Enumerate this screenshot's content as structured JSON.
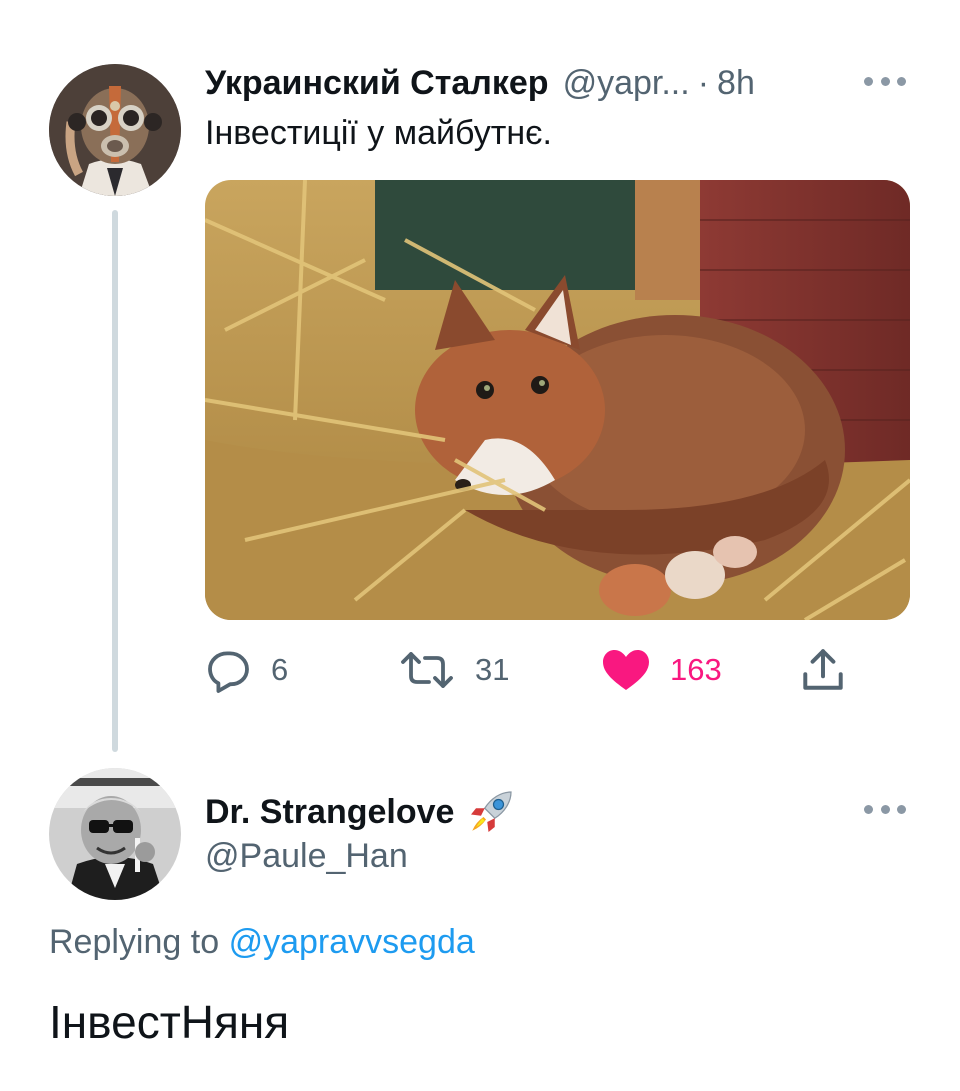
{
  "tweet_1": {
    "display_name": "Украинский Сталкер",
    "handle": "@yapr...",
    "separator": "·",
    "time": "8h",
    "text": "Інвестиції у майбутнє.",
    "avatar_icon": "gas-mask-avatar",
    "media_icon": "fox-in-nest-photo",
    "actions": {
      "reply_count": "6",
      "retweet_count": "31",
      "like_count": "163",
      "liked": true
    }
  },
  "tweet_2": {
    "display_name": "Dr. Strangelove",
    "name_emoji_icon": "rocket-icon",
    "handle": "@Paule_Han",
    "avatar_icon": "strangelove-avatar",
    "replying_prefix": "Replying to",
    "replying_to": "@yapravvsegda",
    "text": "ІнвестНяня"
  },
  "colors": {
    "text_primary": "#0f1419",
    "text_secondary": "#536471",
    "link": "#1d9bf0",
    "like": "#f91880",
    "thread_line": "#cfd9de"
  }
}
